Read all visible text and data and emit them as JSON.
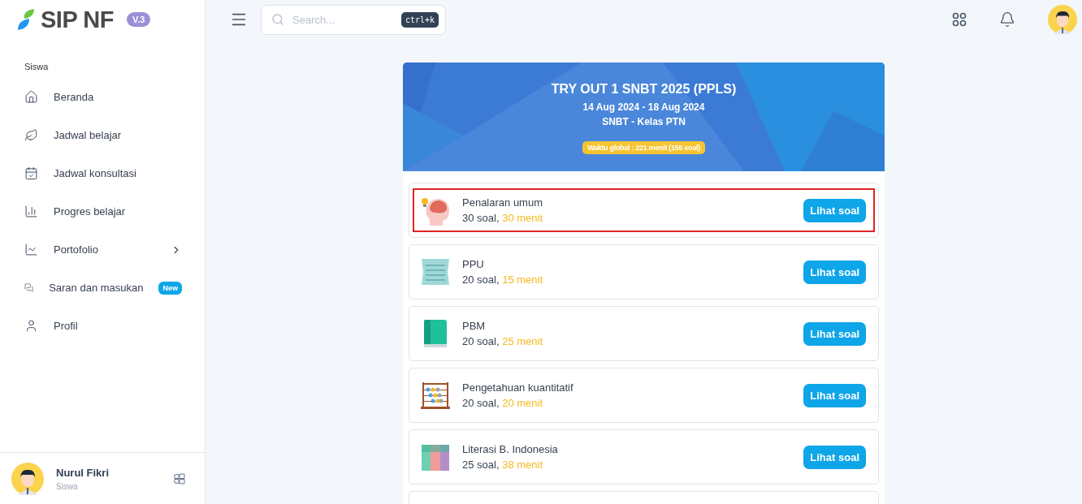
{
  "logo": {
    "name": "SIP NF",
    "version": "V.3"
  },
  "sidebar": {
    "section": "Siswa",
    "items": [
      {
        "label": "Beranda",
        "has_submenu": false
      },
      {
        "label": "Jadwal belajar",
        "has_submenu": false
      },
      {
        "label": "Jadwal konsultasi",
        "has_submenu": false
      },
      {
        "label": "Progres belajar",
        "has_submenu": false
      },
      {
        "label": "Portofolio",
        "has_submenu": true
      },
      {
        "label": "Saran dan masukan",
        "badge": "New",
        "has_submenu": false
      },
      {
        "label": "Profil",
        "has_submenu": false
      }
    ],
    "user": {
      "name": "Nurul Fikri",
      "role": "Siswa"
    }
  },
  "topbar": {
    "search": {
      "placeholder": "Search...",
      "shortcut": "ctrl+k"
    }
  },
  "exam": {
    "title": "TRY OUT 1 SNBT 2025 (PPLS)",
    "dates": "14 Aug 2024 - 18 Aug 2024",
    "class": "SNBT - Kelas PTN",
    "global_time": "Waktu global : 221 menit (155 soal)",
    "subtests": [
      {
        "kind": "brain",
        "name": "Penalaran umum",
        "questions": "30 soal,",
        "duration": "30 menit",
        "button": "Lihat soal",
        "selected": true
      },
      {
        "kind": "paper",
        "name": "PPU",
        "questions": "20 soal,",
        "duration": "15 menit",
        "button": "Lihat soal",
        "selected": false
      },
      {
        "kind": "book",
        "name": "PBM",
        "questions": "20 soal,",
        "duration": "25 menit",
        "button": "Lihat soal",
        "selected": false
      },
      {
        "kind": "abacus",
        "name": "Pengetahuan kuantitatif",
        "questions": "20 soal,",
        "duration": "20 menit",
        "button": "Lihat soal",
        "selected": false
      },
      {
        "kind": "calendar",
        "name": "Literasi B. Indonesia",
        "questions": "25 soal,",
        "duration": "38 menit",
        "button": "Lihat soal",
        "selected": false
      }
    ]
  }
}
